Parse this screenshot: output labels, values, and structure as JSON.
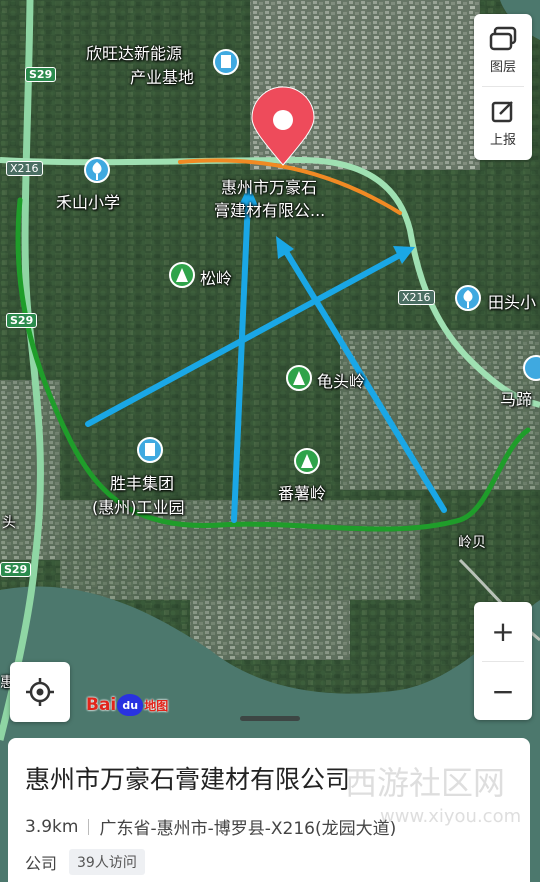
{
  "map_labels": {
    "xinwangda": [
      "欣旺达新能源",
      "产业基地"
    ],
    "heshan_school": "禾山小学",
    "company_pin": [
      "惠州市万豪石",
      "膏建材有限公..."
    ],
    "songling": "松岭",
    "tiantou": "田头小",
    "guitouling": "龟头岭",
    "mati": "马蹄",
    "shengfeng": [
      "胜丰集团",
      "(惠州)工业园"
    ],
    "fanshuling": "番薯岭",
    "lingbei": "岭贝",
    "tou": "头",
    "hui": "惠"
  },
  "road_shields": {
    "s29_top": "S29",
    "s29_mid": "S29",
    "s29_bottom": "S29",
    "x216_left": "X216",
    "x216_right": "X216"
  },
  "controls": {
    "layers_label": "图层",
    "report_label": "上报",
    "zoom_in": "+",
    "zoom_out": "−"
  },
  "logo": {
    "text_left": "Bai",
    "text_mid": "du",
    "text_right": "地图"
  },
  "place": {
    "name": "惠州市万豪石膏建材有限公司",
    "distance": "3.9km",
    "address": "广东省-惠州市-博罗县-X216(龙园大道)",
    "category": "公司",
    "visits": "39人访问"
  },
  "watermark": {
    "line1": "西游社区网",
    "line2": "www.xiyou.com"
  },
  "colors": {
    "arrow": "#1aa7e6",
    "boundary": "#1f9d2a",
    "orange_road": "#f08a24",
    "pin": "#ee4b5b",
    "shield_green": "#2c8b4e"
  }
}
